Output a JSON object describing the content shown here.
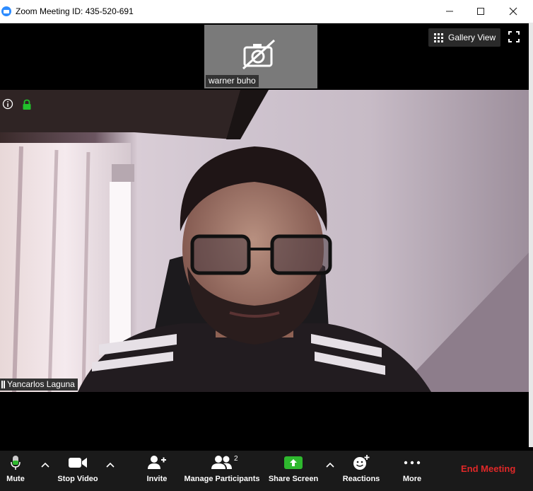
{
  "window": {
    "title": "Zoom Meeting ID: 435-520-691",
    "minimize": "—",
    "maximize": "☐",
    "close": "✕"
  },
  "participants": {
    "thumbnail_name": "warner buho",
    "active_speaker_name": "Yancarlos Laguna"
  },
  "view": {
    "gallery_label": "Gallery View"
  },
  "toolbar": {
    "mute_label": "Mute",
    "stop_video_label": "Stop Video",
    "invite_label": "Invite",
    "manage_participants_label": "Manage Participants",
    "participant_count": "2",
    "share_screen_label": "Share Screen",
    "reactions_label": "Reactions",
    "more_label": "More",
    "end_meeting_label": "End Meeting"
  },
  "colors": {
    "zoom_blue": "#2d8cff",
    "share_green": "#2eb82e",
    "end_red": "#e02828",
    "encryption_green": "#21c12b"
  }
}
